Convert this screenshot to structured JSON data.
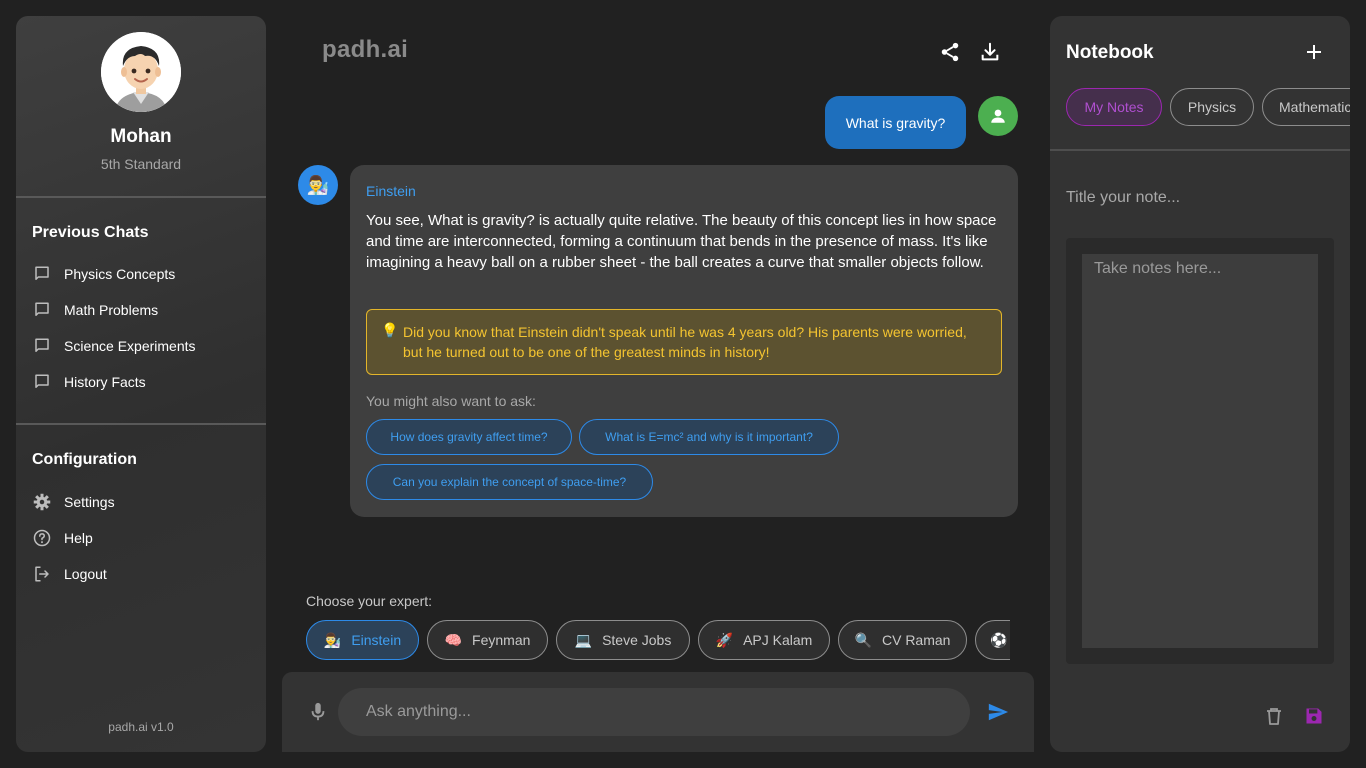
{
  "profile": {
    "name": "Mohan",
    "grade": "5th Standard"
  },
  "sidebar": {
    "previous_title": "Previous Chats",
    "chats": [
      {
        "label": "Physics Concepts",
        "icon": "chat-bubble-icon"
      },
      {
        "label": "Math Problems",
        "icon": "chat-bubble-icon"
      },
      {
        "label": "Science Experiments",
        "icon": "chat-bubble-icon"
      },
      {
        "label": "History Facts",
        "icon": "chat-bubble-icon"
      }
    ],
    "config_title": "Configuration",
    "config": [
      {
        "label": "Settings",
        "icon": "gear-icon"
      },
      {
        "label": "Help",
        "icon": "help-icon"
      },
      {
        "label": "Logout",
        "icon": "logout-icon"
      }
    ],
    "version": "padh.ai v1.0"
  },
  "header": {
    "logo": "padh.ai",
    "share_icon": "share-icon",
    "download_icon": "download-icon"
  },
  "chat": {
    "user_message": "What is gravity?",
    "bot": {
      "name": "Einstein",
      "avatar": "👨‍🔬",
      "text": "You see, What is gravity? is actually quite relative. The beauty of this concept lies in how space and time are interconnected, forming a continuum that bends in the presence of mass. It's like imagining a heavy ball on a rubber sheet - the ball creates a curve that smaller objects follow.",
      "fact_icon": "💡",
      "fact": "Did you know that Einstein didn't speak until he was 4 years old? His parents were worried, but he turned out to be one of the greatest minds in history!",
      "suggest_label": "You might also want to ask:",
      "suggestions": [
        "How does gravity affect time?",
        "What is E=mc² and why is it important?",
        "Can you explain the concept of space-time?"
      ]
    }
  },
  "experts": {
    "label": "Choose your expert:",
    "items": [
      {
        "emoji": "👨‍🔬",
        "name": "Einstein",
        "active": true
      },
      {
        "emoji": "🧠",
        "name": "Feynman"
      },
      {
        "emoji": "💻",
        "name": "Steve Jobs"
      },
      {
        "emoji": "🚀",
        "name": "APJ Kalam"
      },
      {
        "emoji": "🔍",
        "name": "CV Raman"
      },
      {
        "emoji": "⚽",
        "name": ""
      }
    ]
  },
  "input": {
    "placeholder": "Ask anything..."
  },
  "notebook": {
    "title": "Notebook",
    "tabs": [
      "My Notes",
      "Physics",
      "Mathematics"
    ],
    "title_placeholder": "Title your note...",
    "body_placeholder": "Take notes here..."
  },
  "colors": {
    "accent_blue": "#2d8ae8",
    "notebook_purple": "#9c27b0",
    "fact_gold": "#f4c430",
    "user_green": "#4caf50"
  }
}
